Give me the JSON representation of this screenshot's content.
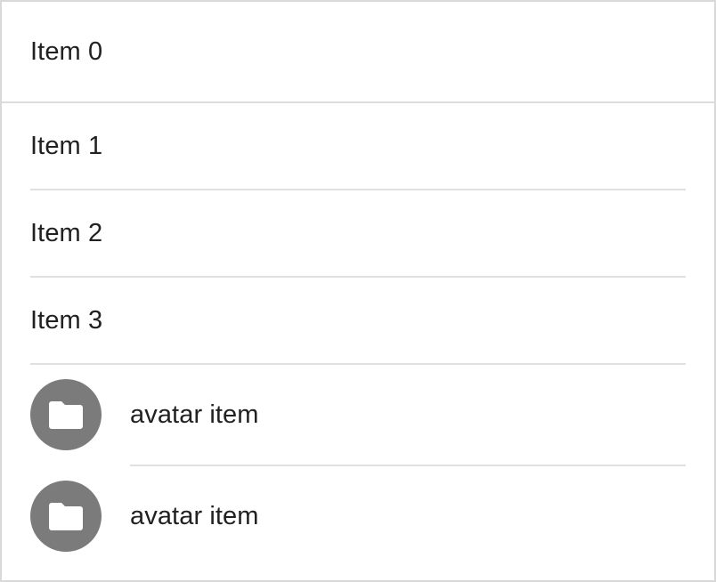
{
  "list": {
    "items": [
      {
        "label": "Item 0"
      },
      {
        "label": "Item 1"
      },
      {
        "label": "Item 2"
      },
      {
        "label": "Item 3"
      }
    ],
    "avatar_items": [
      {
        "label": "avatar item",
        "icon": "folder-icon"
      },
      {
        "label": "avatar item",
        "icon": "folder-icon"
      }
    ]
  },
  "colors": {
    "avatar_background": "#7b7b7b",
    "icon_color": "#ffffff",
    "divider": "#e0e0e0",
    "text": "#212121"
  }
}
